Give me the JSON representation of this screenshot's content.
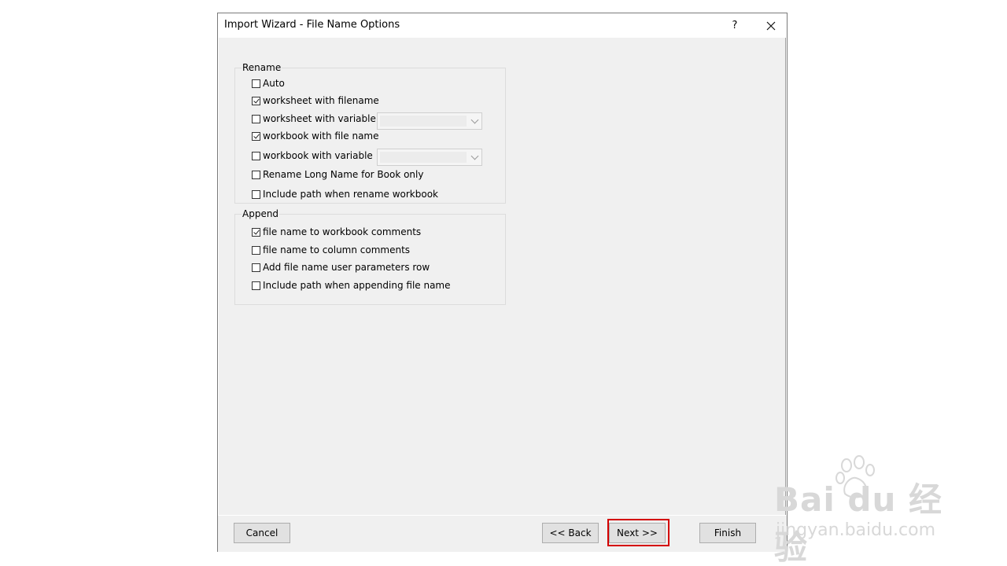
{
  "window": {
    "title": "Import Wizard - File Name Options",
    "help_label": "?",
    "close_label": "✕"
  },
  "rename": {
    "label": "Rename",
    "items": [
      {
        "label": "Auto",
        "checked": false
      },
      {
        "label": "worksheet with filename",
        "checked": true
      },
      {
        "label": "worksheet with variable",
        "checked": false
      },
      {
        "label": "workbook with file name",
        "checked": true
      },
      {
        "label": "workbook with variable",
        "checked": false
      },
      {
        "label": "Rename Long Name for Book only",
        "checked": false
      },
      {
        "label": "Include path when rename workbook",
        "checked": false
      }
    ],
    "worksheet_variable_value": "",
    "workbook_variable_value": ""
  },
  "append": {
    "label": "Append",
    "items": [
      {
        "label": "file name to workbook comments",
        "checked": true
      },
      {
        "label": "file name to column comments",
        "checked": false
      },
      {
        "label": "Add file name user parameters row",
        "checked": false
      },
      {
        "label": "Include path when appending file name",
        "checked": false
      }
    ]
  },
  "footer": {
    "cancel_label": "Cancel",
    "back_label": "<< Back",
    "next_label": "Next >>",
    "finish_label": "Finish"
  },
  "watermark": {
    "logo_text": "Bai du 经验",
    "sub_text": "jingyan.baidu.com"
  },
  "colors": {
    "highlight": "#d40000",
    "panel": "#f0f0f0",
    "button": "#e1e1e1"
  }
}
